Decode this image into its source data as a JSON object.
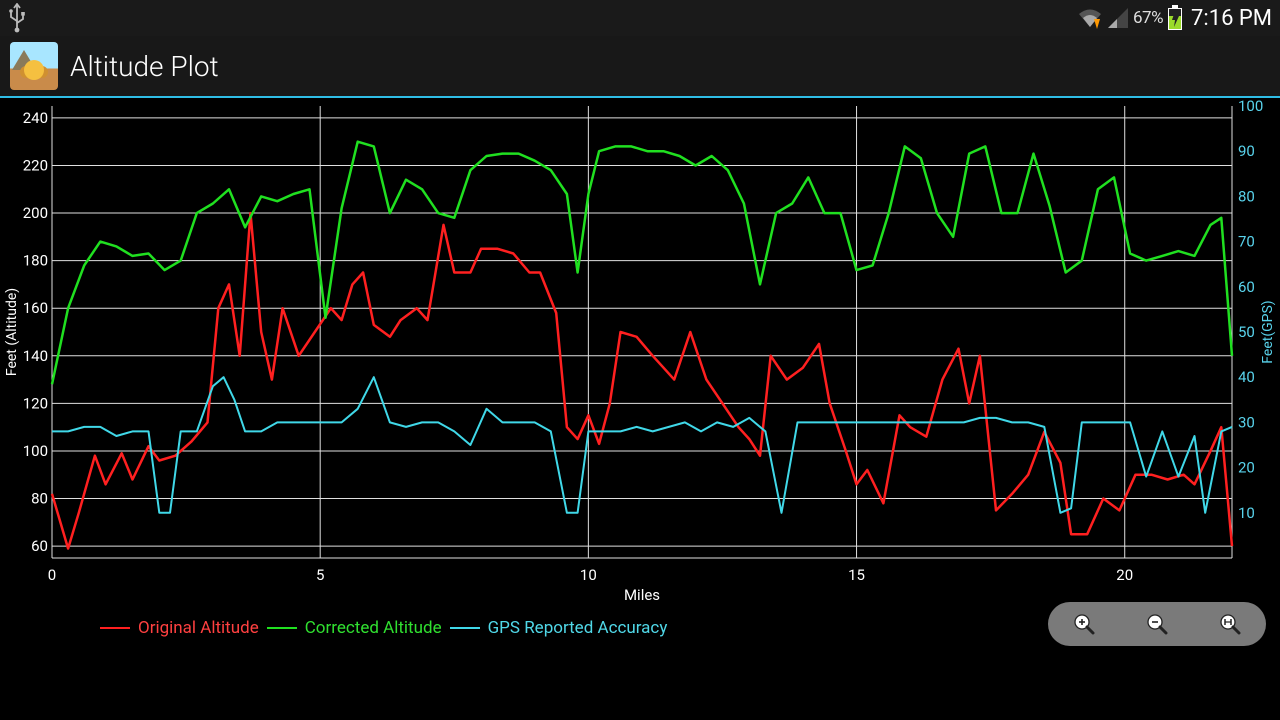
{
  "status_bar": {
    "battery_pct": "67%",
    "clock": "7:16 PM"
  },
  "app_bar": {
    "title": "Altitude Plot"
  },
  "chart_data": {
    "type": "line",
    "xlabel": "Miles",
    "ylabel_left": "Feet (Altitude)",
    "ylabel_right": "Feet(GPS)",
    "x_range": [
      0,
      22
    ],
    "x_ticks": [
      0,
      5,
      10,
      15,
      20
    ],
    "y_left_range": [
      55,
      245
    ],
    "y_left_ticks": [
      60,
      80,
      100,
      120,
      140,
      160,
      180,
      200,
      220,
      240
    ],
    "y_right_range": [
      0,
      100
    ],
    "y_right_ticks": [
      10,
      20,
      30,
      40,
      50,
      60,
      70,
      80,
      90,
      100
    ],
    "series": [
      {
        "name": "Original Altitude",
        "axis": "left",
        "color": "#ff2020",
        "x": [
          0,
          0.3,
          0.5,
          0.8,
          1.0,
          1.3,
          1.5,
          1.8,
          2.0,
          2.3,
          2.6,
          2.9,
          3.1,
          3.3,
          3.5,
          3.7,
          3.9,
          4.1,
          4.3,
          4.6,
          4.9,
          5.2,
          5.4,
          5.6,
          5.8,
          6.0,
          6.3,
          6.5,
          6.8,
          7.0,
          7.3,
          7.5,
          7.8,
          8.0,
          8.3,
          8.6,
          8.9,
          9.1,
          9.4,
          9.6,
          9.8,
          10.0,
          10.2,
          10.4,
          10.6,
          10.9,
          11.2,
          11.4,
          11.6,
          11.9,
          12.2,
          12.5,
          12.8,
          13.0,
          13.2,
          13.4,
          13.7,
          14.0,
          14.3,
          14.5,
          14.8,
          15.0,
          15.2,
          15.5,
          15.8,
          16.0,
          16.3,
          16.6,
          16.9,
          17.1,
          17.3,
          17.6,
          17.9,
          18.2,
          18.5,
          18.8,
          19.0,
          19.3,
          19.6,
          19.9,
          20.2,
          20.5,
          20.8,
          21.1,
          21.3,
          21.6,
          21.8,
          22.0
        ],
        "values": [
          82,
          59,
          74,
          98,
          86,
          99,
          88,
          102,
          96,
          98,
          104,
          112,
          160,
          170,
          140,
          200,
          150,
          130,
          160,
          140,
          150,
          160,
          155,
          170,
          175,
          153,
          148,
          155,
          160,
          155,
          195,
          175,
          175,
          185,
          185,
          183,
          175,
          175,
          158,
          110,
          105,
          115,
          103,
          120,
          150,
          148,
          140,
          135,
          130,
          150,
          130,
          120,
          110,
          105,
          98,
          140,
          130,
          135,
          145,
          120,
          100,
          86,
          92,
          78,
          115,
          110,
          106,
          130,
          143,
          120,
          140,
          75,
          82,
          90,
          108,
          95,
          65,
          65,
          80,
          75,
          90,
          90,
          88,
          90,
          86,
          100,
          110,
          60
        ]
      },
      {
        "name": "Corrected Altitude",
        "axis": "left",
        "color": "#20e020",
        "x": [
          0,
          0.3,
          0.6,
          0.9,
          1.2,
          1.5,
          1.8,
          2.1,
          2.4,
          2.7,
          3.0,
          3.3,
          3.6,
          3.9,
          4.2,
          4.5,
          4.8,
          5.1,
          5.4,
          5.7,
          6.0,
          6.3,
          6.6,
          6.9,
          7.2,
          7.5,
          7.8,
          8.1,
          8.4,
          8.7,
          9.0,
          9.3,
          9.6,
          9.8,
          10.0,
          10.2,
          10.5,
          10.8,
          11.1,
          11.4,
          11.7,
          12.0,
          12.3,
          12.6,
          12.9,
          13.2,
          13.5,
          13.8,
          14.1,
          14.4,
          14.7,
          15.0,
          15.3,
          15.6,
          15.9,
          16.2,
          16.5,
          16.8,
          17.1,
          17.4,
          17.7,
          18.0,
          18.3,
          18.6,
          18.9,
          19.2,
          19.5,
          19.8,
          20.1,
          20.4,
          20.7,
          21.0,
          21.3,
          21.6,
          21.8,
          22.0
        ],
        "values": [
          128,
          160,
          178,
          188,
          186,
          182,
          183,
          176,
          180,
          200,
          204,
          210,
          194,
          207,
          205,
          208,
          210,
          156,
          202,
          230,
          228,
          200,
          214,
          210,
          200,
          198,
          218,
          224,
          225,
          225,
          222,
          218,
          208,
          175,
          208,
          226,
          228,
          228,
          226,
          226,
          224,
          220,
          224,
          218,
          204,
          170,
          200,
          204,
          215,
          200,
          200,
          176,
          178,
          200,
          228,
          223,
          200,
          190,
          225,
          228,
          200,
          200,
          225,
          203,
          175,
          180,
          210,
          215,
          183,
          180,
          182,
          184,
          182,
          195,
          198,
          140
        ]
      },
      {
        "name": "GPS Reported Accuracy",
        "axis": "right",
        "color": "#40d8e8",
        "x": [
          0,
          0.3,
          0.6,
          0.9,
          1.2,
          1.5,
          1.8,
          2.0,
          2.2,
          2.4,
          2.7,
          3.0,
          3.2,
          3.4,
          3.6,
          3.9,
          4.2,
          4.5,
          4.8,
          5.1,
          5.4,
          5.7,
          6.0,
          6.3,
          6.6,
          6.9,
          7.2,
          7.5,
          7.8,
          8.1,
          8.4,
          8.7,
          9.0,
          9.3,
          9.6,
          9.8,
          10.0,
          10.3,
          10.6,
          10.9,
          11.2,
          11.5,
          11.8,
          12.1,
          12.4,
          12.7,
          13.0,
          13.3,
          13.6,
          13.9,
          14.2,
          14.5,
          14.8,
          15.0,
          15.2,
          15.5,
          15.8,
          16.1,
          16.4,
          16.7,
          17.0,
          17.3,
          17.6,
          17.9,
          18.2,
          18.5,
          18.8,
          19.0,
          19.2,
          19.5,
          19.8,
          20.1,
          20.4,
          20.7,
          21.0,
          21.3,
          21.5,
          21.8,
          22.0
        ],
        "values": [
          28,
          28,
          29,
          29,
          27,
          28,
          28,
          10,
          10,
          28,
          28,
          38,
          40,
          35,
          28,
          28,
          30,
          30,
          30,
          30,
          30,
          33,
          40,
          30,
          29,
          30,
          30,
          28,
          25,
          33,
          30,
          30,
          30,
          28,
          10,
          10,
          28,
          28,
          28,
          29,
          28,
          29,
          30,
          28,
          30,
          29,
          31,
          28,
          10,
          30,
          30,
          30,
          30,
          30,
          30,
          30,
          30,
          30,
          30,
          30,
          30,
          31,
          31,
          30,
          30,
          29,
          10,
          11,
          30,
          30,
          30,
          30,
          18,
          28,
          18,
          27,
          10,
          28,
          29
        ]
      }
    ]
  },
  "legend": {
    "orig": "Original Altitude",
    "corr": "Corrected Altitude",
    "gps": "GPS Reported Accuracy"
  }
}
